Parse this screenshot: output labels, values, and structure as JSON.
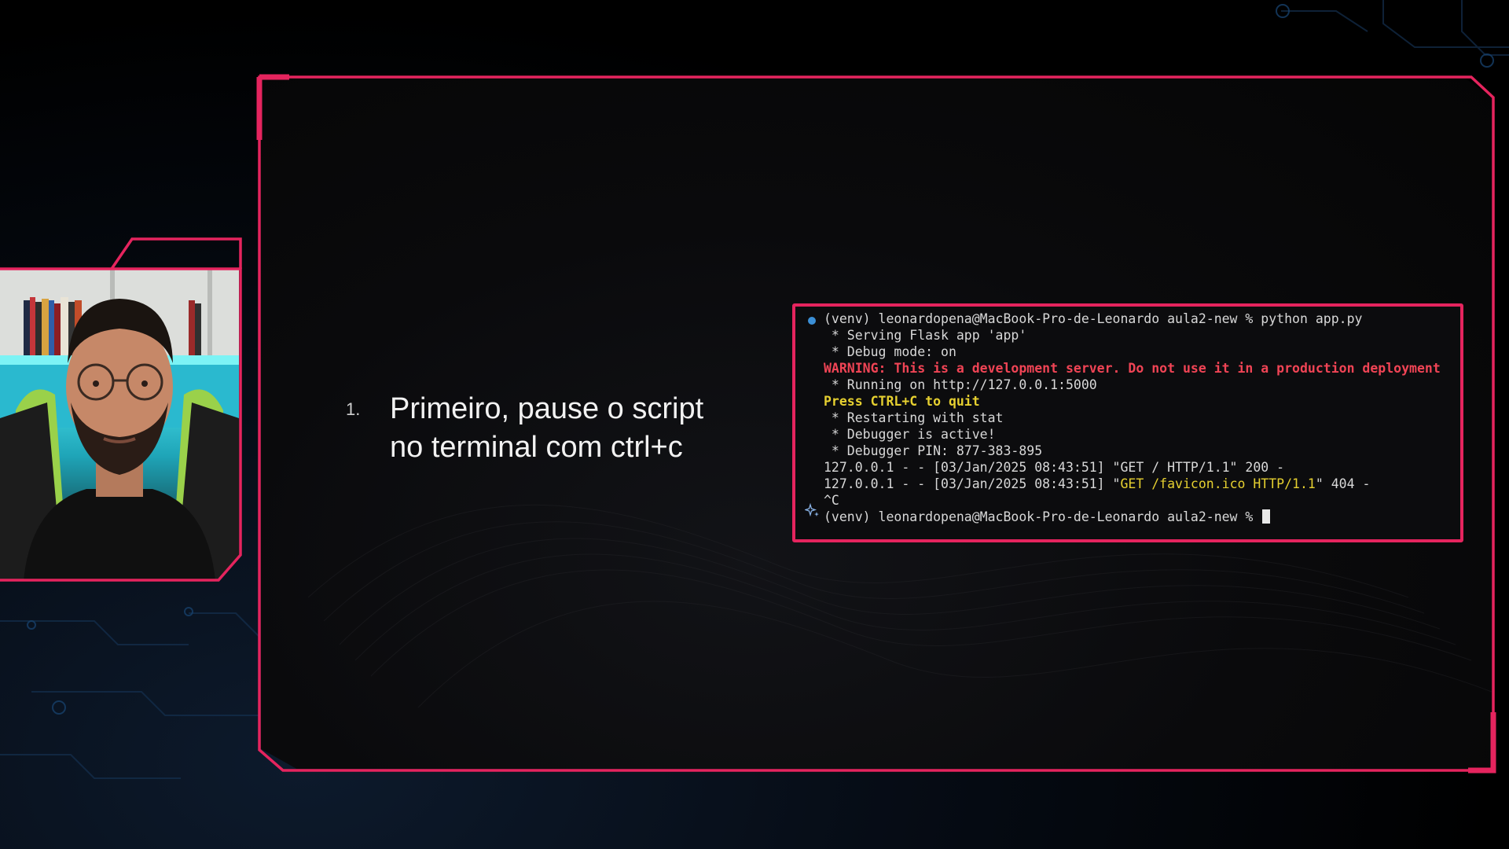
{
  "slide": {
    "step_number": "1.",
    "step_text_line1": "Primeiro, pause o script",
    "step_text_line2": "no terminal com ctrl+c"
  },
  "terminal": {
    "lines": [
      "(venv) leonardopena@MacBook-Pro-de-Leonardo aula2-new % python app.py",
      " * Serving Flask app 'app'",
      " * Debug mode: on",
      "WARNING: This is a development server. Do not use it in a production deployment",
      " * Running on http://127.0.0.1:5000",
      "Press CTRL+C to quit",
      " * Restarting with stat",
      " * Debugger is active!",
      " * Debugger PIN: 877-383-895",
      "127.0.0.1 - - [03/Jan/2025 08:43:51] \"GET / HTTP/1.1\" 200 -",
      "127.0.0.1 - - [03/Jan/2025 08:43:51] \"",
      "GET /favicon.ico HTTP/1.1",
      "\" 404 -",
      "^C",
      "(venv) leonardopena@MacBook-Pro-de-Leonardo aula2-new % "
    ]
  },
  "colors": {
    "accent": "#e5245e",
    "warning": "#f04455",
    "highlight": "#e6d030",
    "prompt_dot": "#3b8fd6"
  },
  "icons": [
    "prompt-dot-icon",
    "sparkle-icon",
    "cursor-icon"
  ]
}
